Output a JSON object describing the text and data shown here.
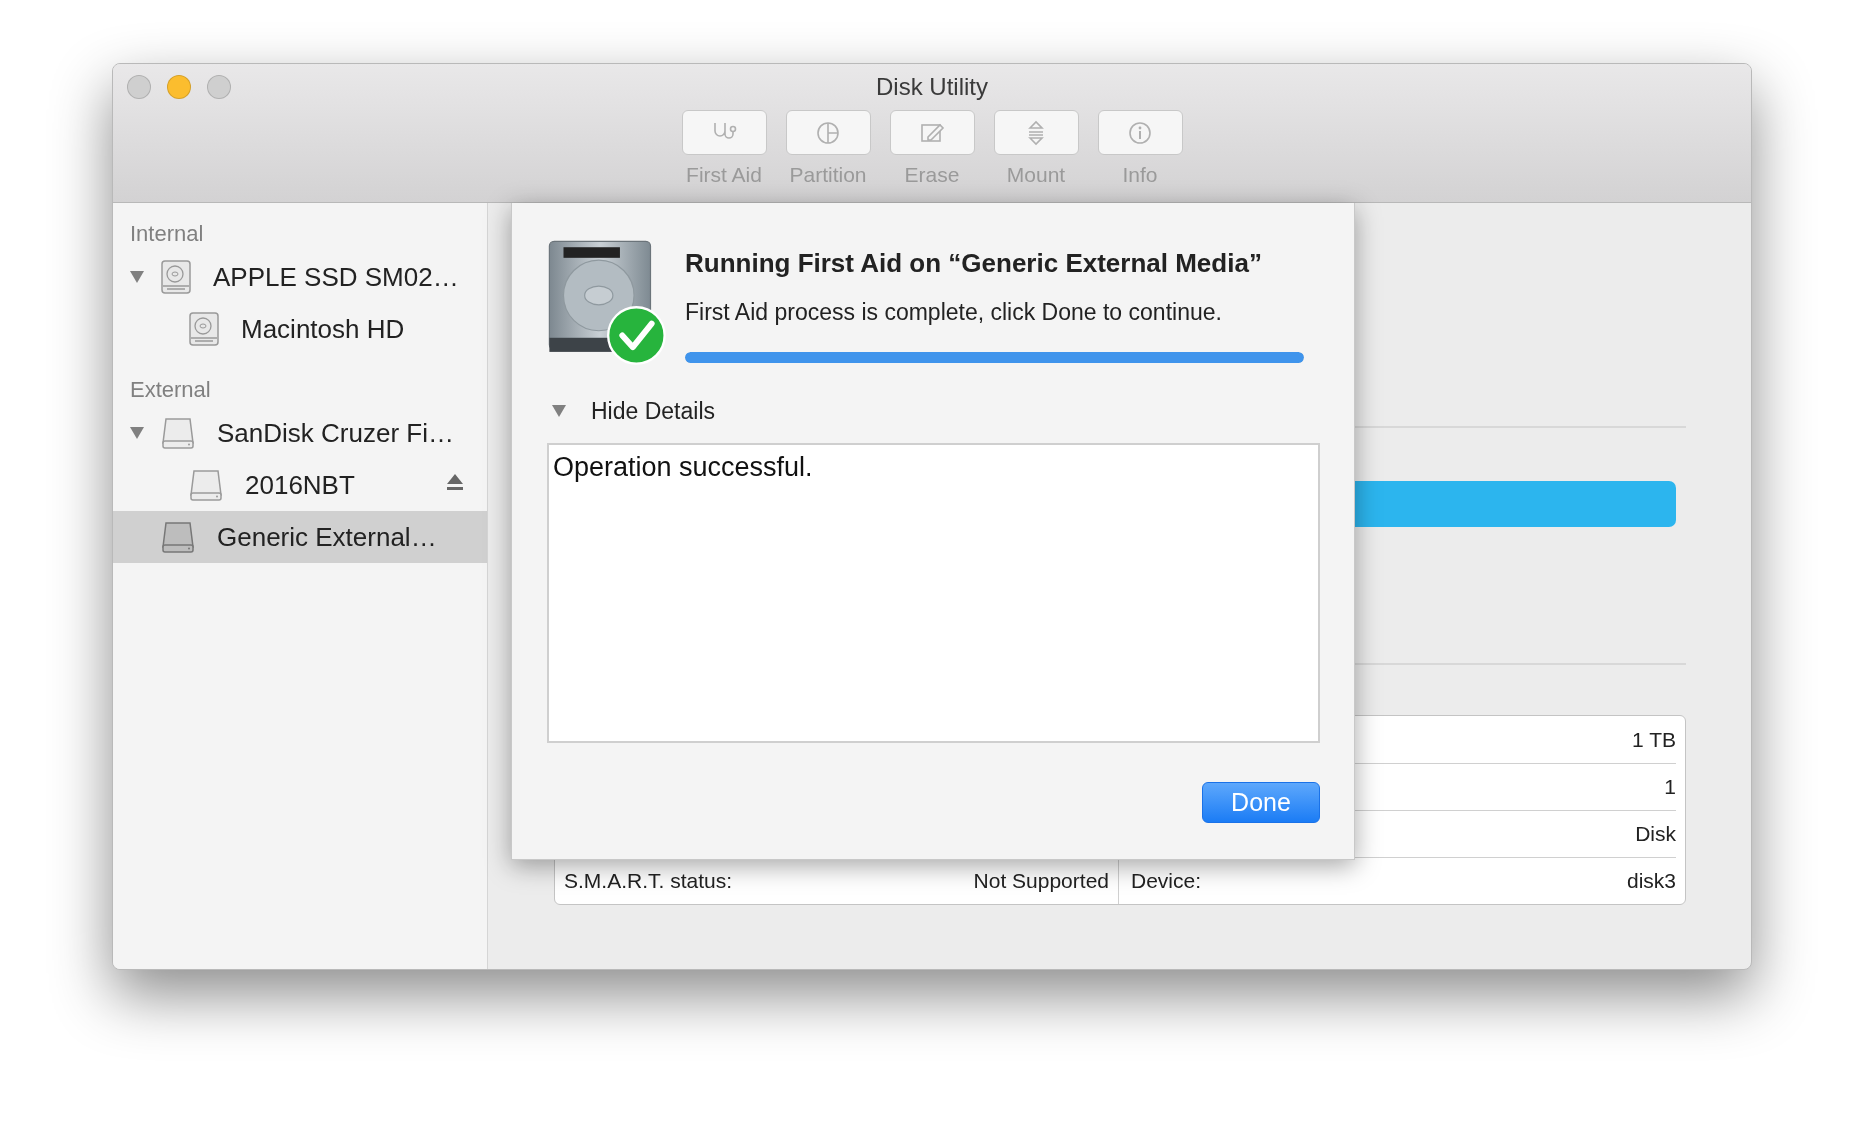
{
  "window": {
    "title": "Disk Utility"
  },
  "toolbar": [
    {
      "label": "First Aid",
      "kind": "first-aid",
      "disabled": true
    },
    {
      "label": "Partition",
      "kind": "partition",
      "disabled": true
    },
    {
      "label": "Erase",
      "kind": "erase",
      "disabled": true
    },
    {
      "label": "Mount",
      "kind": "mount",
      "disabled": true
    },
    {
      "label": "Info",
      "kind": "info",
      "disabled": true
    }
  ],
  "sidebar": {
    "sections": [
      {
        "title": "Internal",
        "items": [
          {
            "label": "APPLE SSD SM02…",
            "kind": "internal",
            "expanded": true,
            "selected": false,
            "ejectable": false,
            "children": [
              {
                "label": "Macintosh HD",
                "kind": "internal",
                "selected": false,
                "ejectable": false
              }
            ]
          }
        ]
      },
      {
        "title": "External",
        "items": [
          {
            "label": "SanDisk Cruzer Fi…",
            "kind": "external",
            "expanded": true,
            "selected": false,
            "ejectable": false,
            "children": [
              {
                "label": "2016NBT",
                "kind": "external",
                "selected": false,
                "ejectable": true
              }
            ]
          },
          {
            "label": "Generic External…",
            "kind": "external",
            "selected": true,
            "ejectable": false
          }
        ]
      }
    ]
  },
  "info_table": {
    "rows": [
      {
        "right_value": "1 TB"
      },
      {
        "right_value": "1"
      },
      {
        "right_value": "Disk"
      },
      {
        "left_label": "S.M.A.R.T. status:",
        "left_value": "Not Supported",
        "right_label": "Device:",
        "right_value": "disk3"
      }
    ]
  },
  "dialog": {
    "title": "Running First Aid on “Generic External Media”",
    "message": "First Aid process is complete, click Done to continue.",
    "progress": {
      "level": 1
    },
    "details": {
      "label": "Hide Details",
      "expanded": true,
      "text": "Operation successful."
    },
    "button": "Done"
  }
}
